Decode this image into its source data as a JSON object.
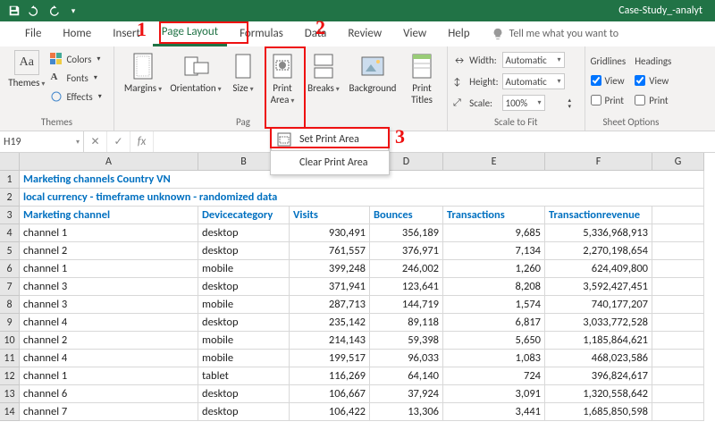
{
  "titlebar": {
    "doc_title": "Case-Study_-analyt"
  },
  "tabs": {
    "file": "File",
    "home": "Home",
    "insert": "Insert",
    "page_layout": "Page Layout",
    "formulas": "Formulas",
    "data": "Data",
    "review": "Review",
    "view": "View",
    "help": "Help",
    "tell_me": "Tell me what you want to"
  },
  "annotations": {
    "one": "1",
    "two": "2",
    "three": "3"
  },
  "ribbon": {
    "themes_group": "Themes",
    "page_group": "Pag",
    "scale_group": "Scale to Fit",
    "sheet_group": "Sheet Options",
    "themes_label": "Themes",
    "colors": "Colors",
    "fonts": "Fonts",
    "effects": "Effects",
    "margins": "Margins",
    "orientation": "Orientation",
    "size": "Size",
    "print_area": "Print\nArea",
    "breaks": "Breaks",
    "background": "Background",
    "print_titles": "Print\nTitles",
    "width": "Width:",
    "height": "Height:",
    "scale": "Scale:",
    "automatic": "Automatic",
    "pct": "100%",
    "gridlines": "Gridlines",
    "headings": "Headings",
    "view": "View",
    "print": "Print",
    "menu_set": "Set Print Area",
    "menu_clear": "Clear Print Area"
  },
  "fbar": {
    "name": "H19",
    "fx": "fx"
  },
  "columns": [
    "A",
    "B",
    "C",
    "D",
    "E",
    "F",
    "G"
  ],
  "rows": [
    "1",
    "2",
    "3",
    "4",
    "5",
    "6",
    "7",
    "8",
    "9",
    "10",
    "11",
    "12",
    "13",
    "14"
  ],
  "header_row": {
    "a": "Marketing channel",
    "b": "Devicecategory",
    "c": "Visits",
    "d": "Bounces",
    "e": "Transactions",
    "f": "Transactionrevenue"
  },
  "title1": "Marketing channels Country VN",
  "title2": "local currency - timeframe unknown - randomized data",
  "data": [
    {
      "a": "channel 1",
      "b": "desktop",
      "c": "930,491",
      "d": "356,189",
      "e": "9,685",
      "f": "5,336,968,913"
    },
    {
      "a": "channel 2",
      "b": "desktop",
      "c": "761,557",
      "d": "376,971",
      "e": "7,134",
      "f": "2,270,198,654"
    },
    {
      "a": "channel 1",
      "b": "mobile",
      "c": "399,248",
      "d": "246,002",
      "e": "1,260",
      "f": "624,409,800"
    },
    {
      "a": "channel 3",
      "b": "desktop",
      "c": "371,941",
      "d": "123,641",
      "e": "8,208",
      "f": "3,592,427,451"
    },
    {
      "a": "channel 3",
      "b": "mobile",
      "c": "287,713",
      "d": "144,719",
      "e": "1,574",
      "f": "740,177,207"
    },
    {
      "a": "channel 4",
      "b": "desktop",
      "c": "235,142",
      "d": "89,118",
      "e": "6,817",
      "f": "3,033,772,528"
    },
    {
      "a": "channel 2",
      "b": "mobile",
      "c": "214,143",
      "d": "59,398",
      "e": "5,650",
      "f": "1,185,864,621"
    },
    {
      "a": "channel 4",
      "b": "mobile",
      "c": "199,517",
      "d": "96,033",
      "e": "1,083",
      "f": "468,023,586"
    },
    {
      "a": "channel 1",
      "b": "tablet",
      "c": "116,269",
      "d": "64,140",
      "e": "724",
      "f": "396,824,617"
    },
    {
      "a": "channel 6",
      "b": "desktop",
      "c": "106,667",
      "d": "37,924",
      "e": "3,091",
      "f": "1,320,558,642"
    },
    {
      "a": "channel 7",
      "b": "desktop",
      "c": "106,422",
      "d": "13,306",
      "e": "3,441",
      "f": "1,685,850,598"
    }
  ]
}
